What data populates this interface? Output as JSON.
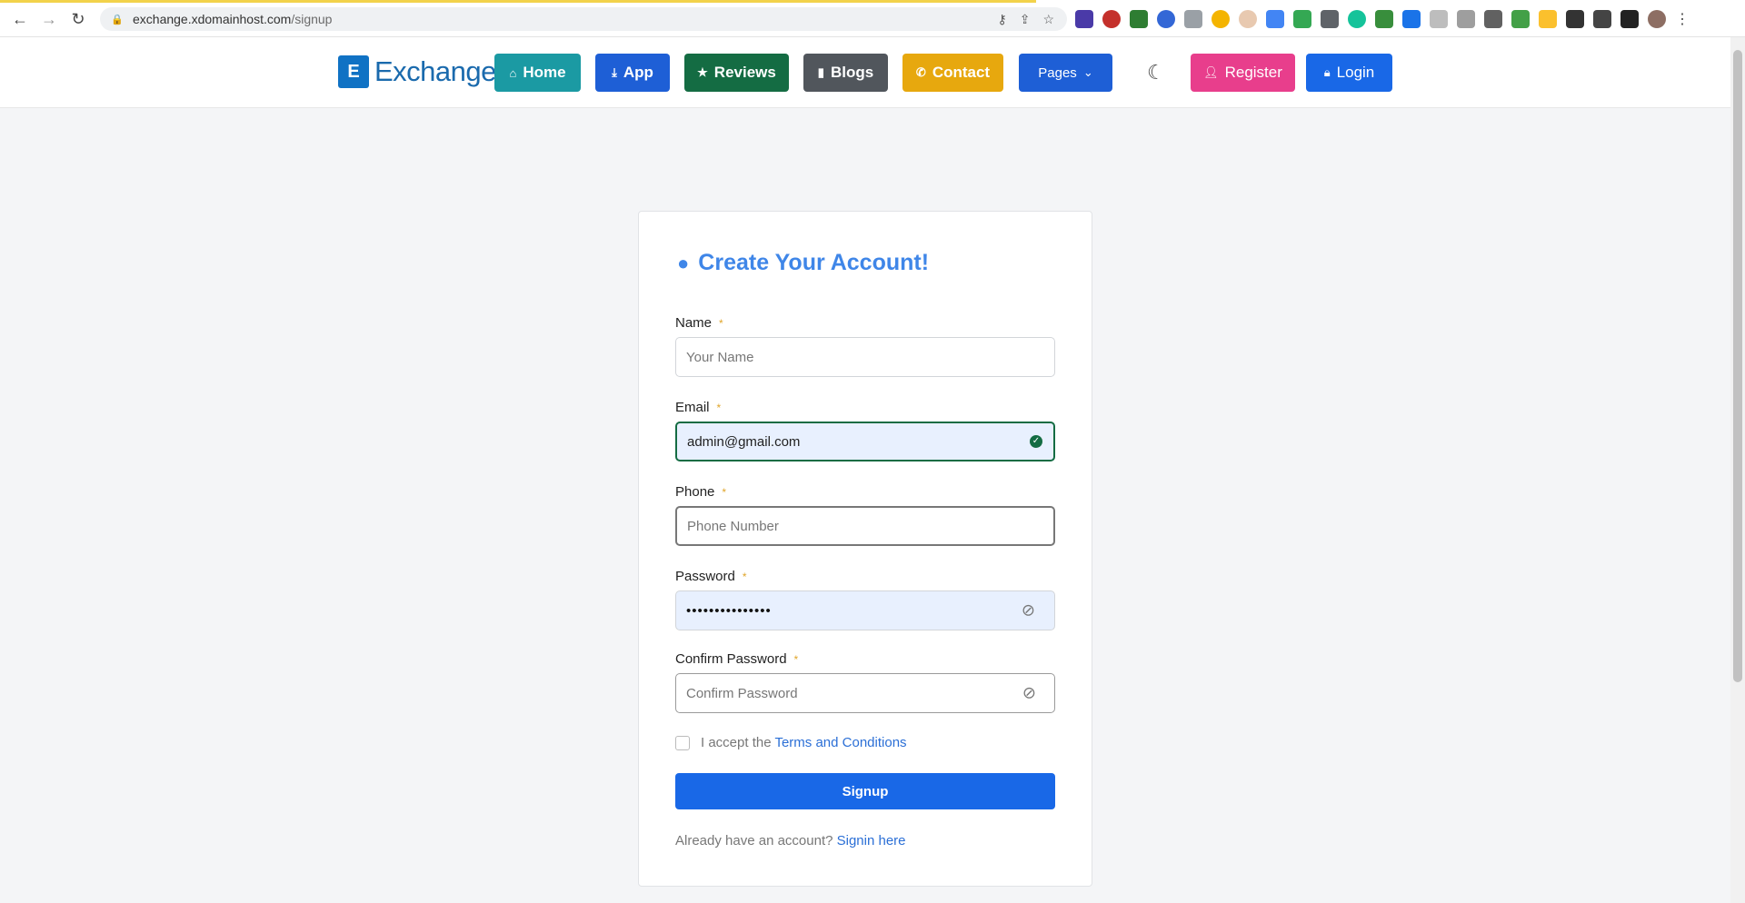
{
  "browser": {
    "url_host": "exchange.xdomainhost.com",
    "url_path": "/signup"
  },
  "header": {
    "logo_text": "Exchange",
    "nav": {
      "home": "Home",
      "app": "App",
      "reviews": "Reviews",
      "blogs": "Blogs",
      "contact": "Contact",
      "pages": "Pages"
    },
    "register": "Register",
    "login": "Login",
    "colors": {
      "home": "#1b9aa3",
      "app": "#1e5fd6",
      "reviews": "#146c43",
      "blogs": "#51565c",
      "contact": "#e7a80e",
      "pages": "#1e5fd6",
      "register": "#e83e8c",
      "login": "#1968e7"
    }
  },
  "form": {
    "title": "Create Your Account!",
    "name_label": "Name",
    "name_placeholder": "Your Name",
    "email_label": "Email",
    "email_value": "admin@gmail.com",
    "phone_label": "Phone",
    "phone_placeholder": "Phone Number",
    "password_label": "Password",
    "password_value": "•••••••••••••••",
    "confirm_label": "Confirm Password",
    "confirm_placeholder": "Confirm Password",
    "required_mark": "*",
    "terms_prefix": "I accept the",
    "terms_link": "Terms and Conditions",
    "signup_button": "Signup",
    "already_text": "Already have an account?",
    "signin_link": "Signin here"
  }
}
